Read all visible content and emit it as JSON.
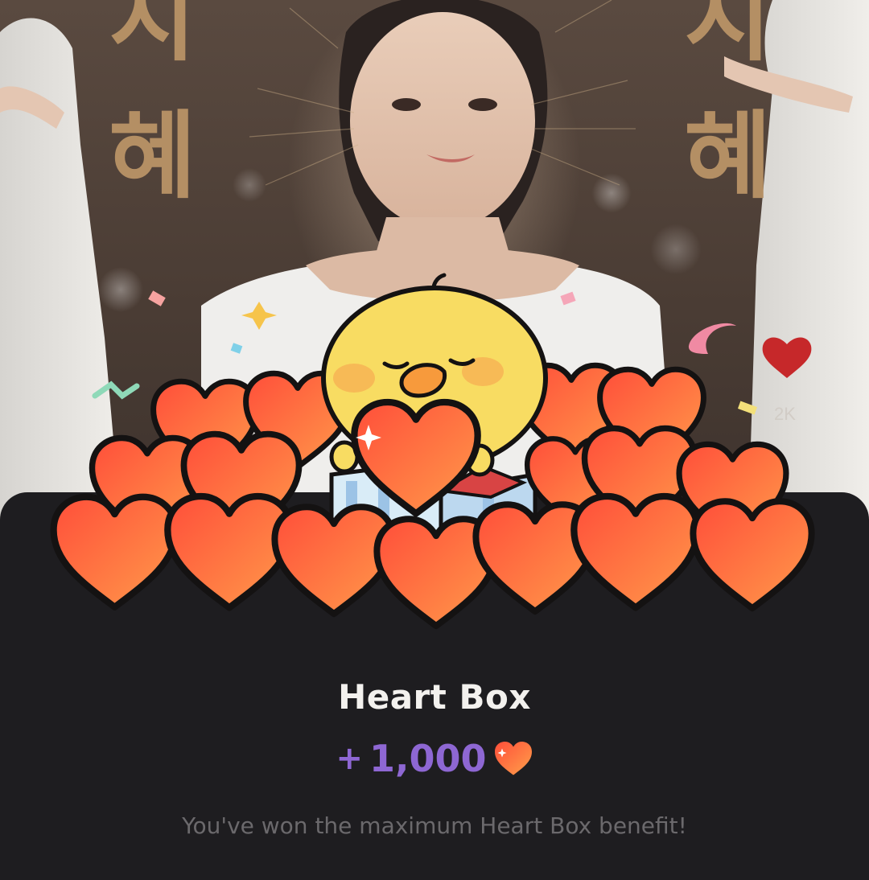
{
  "background": {
    "side_text_left": "지\n혜",
    "side_text_right": "지\n혜",
    "heart_count": "2K"
  },
  "dialog": {
    "title": "Heart Box",
    "reward_sign": "+",
    "reward_amount": "1,000",
    "reward_icon": "heart-icon",
    "message": "You've won the maximum Heart Box benefit!"
  },
  "colors": {
    "sheet_bg": "#1e1d20",
    "title": "#f3f1ee",
    "reward": "#8e67d3",
    "message": "#6b696c",
    "heart": "#ff6a3d"
  }
}
